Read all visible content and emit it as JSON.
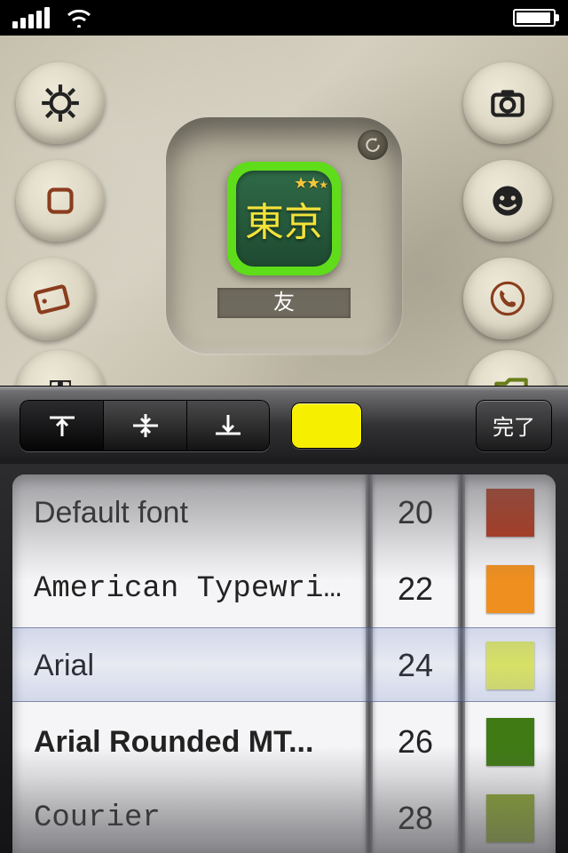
{
  "statusbar": {
    "signal": 5,
    "wifi": true,
    "battery_pct": 90
  },
  "preview": {
    "icon_text": "東京",
    "icon_label": "友",
    "icon_bg": "#245a3c",
    "icon_border": "#5fdc1a",
    "icon_text_color": "#f3e23a"
  },
  "side_tools": {
    "left": [
      "settings-gear",
      "shape-square",
      "rotate-card",
      "text-tool"
    ],
    "right": [
      "camera",
      "face-emoji",
      "phone",
      "folder"
    ]
  },
  "toolbar": {
    "align_options": [
      "align-top",
      "align-middle",
      "align-bottom"
    ],
    "align_selected": 0,
    "text_color": "#f7ef00",
    "done_label": "完了"
  },
  "picker": {
    "selected_index": 2,
    "fonts": [
      "Default font",
      "American Typewri...",
      "Arial",
      "Arial Rounded MT...",
      "Courier"
    ],
    "sizes": [
      "20",
      "22",
      "24",
      "26",
      "28"
    ],
    "colors": [
      "#b53316",
      "#ef8f1f",
      "#e2ea5a",
      "#3f7a14",
      "#8aa52e"
    ]
  }
}
